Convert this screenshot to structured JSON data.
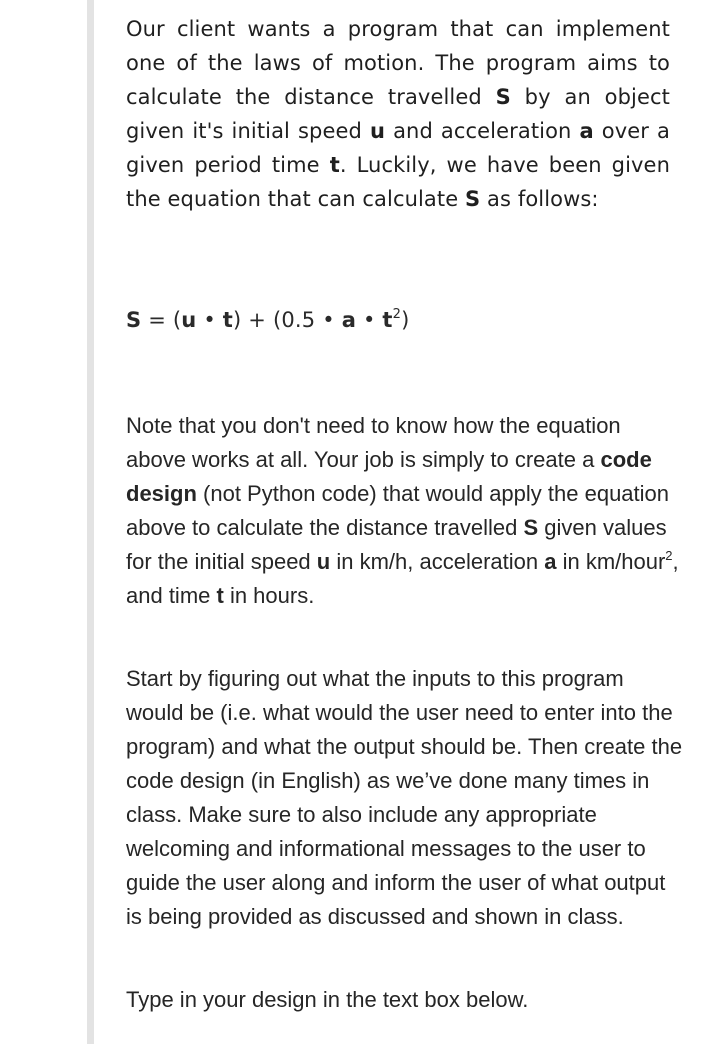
{
  "intro": {
    "t1": "Our client wants a program that can implement one of the laws of motion. The program aims to calculate the distance travelled ",
    "b1": "S",
    "t2": " by an object given it's initial speed ",
    "b2": "u",
    "t3": " and acceleration ",
    "b3": "a",
    "t4": " over a given period time ",
    "b4": "t",
    "t5": ". Luckily, we have been given the equation that can calculate ",
    "b5": "S",
    "t6": " as follows:"
  },
  "equation": {
    "s": "S",
    "eq": " = (",
    "u": "u",
    "dot1": " • ",
    "t": "t",
    "mid": ") + (0.5 • ",
    "a": "a",
    "dot2": " • ",
    "t2": "t",
    "exp": "2",
    "close": ")"
  },
  "note": {
    "t1": "Note that you don't need to know how the equation above works at all. Your job is simply to create a ",
    "b1": "code design",
    "t2": " (not Python code) that would apply the equation above to calculate the distance travelled ",
    "b2": "S",
    "t3": " given values for the initial speed ",
    "b3": "u",
    "t4": " in km/h, acceleration ",
    "b4": "a",
    "t5": " in km/hour",
    "sup": "2",
    "t6": ", and time ",
    "b5": "t",
    "t7": " in hours."
  },
  "start": {
    "text": "Start by figuring out what the inputs to this program would be (i.e. what would the user need to enter into the program) and what the output should be. Then create the code design (in English) as we’ve done many times in class. Make sure to also include any appropriate welcoming and informational messages to the user to guide the user along and inform the user of what output is being provided as discussed and shown in class."
  },
  "instruction": {
    "text": "Type in your design in the text box below."
  }
}
